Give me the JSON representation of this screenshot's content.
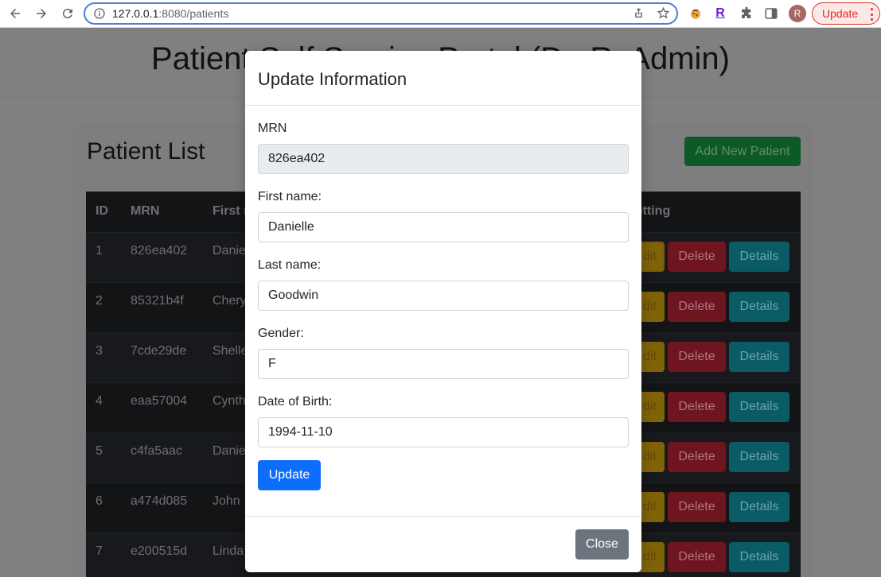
{
  "browser": {
    "url_host": "127.0.0.1",
    "url_path": ":8080/patients",
    "profile_initial": "R",
    "update_label": "Update",
    "extension_r_label": "R"
  },
  "page": {
    "title": "Patient Self Service Portal (Dr. R. Admin)",
    "card_title": "Patient List",
    "add_button": "Add New Patient",
    "columns": [
      "ID",
      "MRN",
      "First name",
      "Setting"
    ],
    "rows": [
      {
        "id": "1",
        "mrn": "826ea402",
        "first": "Danie"
      },
      {
        "id": "2",
        "mrn": "85321b4f",
        "first": "Chery"
      },
      {
        "id": "3",
        "mrn": "7cde29de",
        "first": "Shelle"
      },
      {
        "id": "4",
        "mrn": "eaa57004",
        "first": "Cynth"
      },
      {
        "id": "5",
        "mrn": "c4fa5aac",
        "first": "Danie"
      },
      {
        "id": "6",
        "mrn": "a474d085",
        "first": "John"
      },
      {
        "id": "7",
        "mrn": "e200515d",
        "first": "Linda"
      }
    ],
    "actions": {
      "edit": "dit",
      "delete": "Delete",
      "details": "Details"
    }
  },
  "modal": {
    "title": "Update Information",
    "fields": {
      "mrn": {
        "label": "MRN",
        "value": "826ea402"
      },
      "first_name": {
        "label": "First name:",
        "value": "Danielle"
      },
      "last_name": {
        "label": "Last name:",
        "value": "Goodwin"
      },
      "gender": {
        "label": "Gender:",
        "value": "F"
      },
      "dob": {
        "label": "Date of Birth:",
        "value": "1994-11-10"
      }
    },
    "update_button": "Update",
    "close_button": "Close"
  }
}
